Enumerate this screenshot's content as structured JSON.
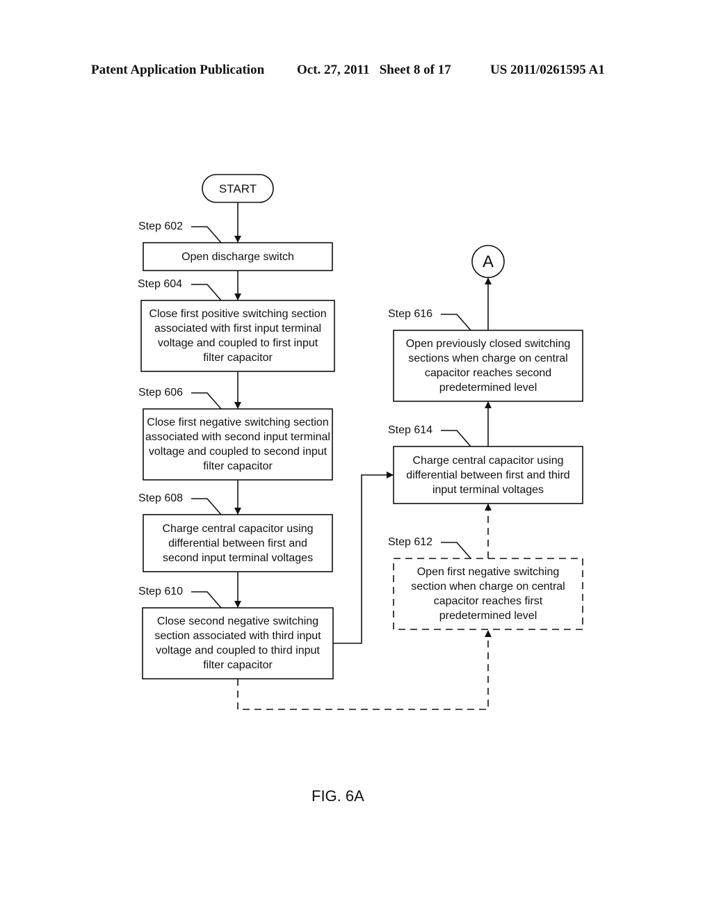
{
  "header": {
    "publication": "Patent Application Publication",
    "date_sheet": "Oct. 27, 2011   Sheet 8 of 17",
    "number": "US 2011/0261595 A1"
  },
  "diagram": {
    "start": "START",
    "connector": "A",
    "steps": [
      {
        "id": "602",
        "label": "Step 602",
        "text": "Open discharge switch",
        "style": "solid"
      },
      {
        "id": "604",
        "label": "Step 604",
        "text": "Close first positive switching section associated with first input terminal voltage and coupled to first input filter capacitor",
        "style": "solid"
      },
      {
        "id": "606",
        "label": "Step 606",
        "text": "Close first negative switching section associated with second input terminal voltage and coupled to second input filter capacitor",
        "style": "solid"
      },
      {
        "id": "608",
        "label": "Step 608",
        "text": "Charge central capacitor using differential between first and second input terminal voltages",
        "style": "solid"
      },
      {
        "id": "610",
        "label": "Step 610",
        "text": "Close second negative switching section associated with third input voltage and coupled to third input filter capacitor",
        "style": "solid"
      },
      {
        "id": "612",
        "label": "Step 612",
        "text": "Open first negative switching section when charge on central capacitor reaches first predetermined level",
        "style": "dashed"
      },
      {
        "id": "614",
        "label": "Step 614",
        "text": "Charge central capacitor using differential between first and third input terminal voltages",
        "style": "solid"
      },
      {
        "id": "616",
        "label": "Step 616",
        "text": "Open previously closed switching sections when charge on central capacitor reaches second predetermined level",
        "style": "solid"
      }
    ],
    "edges": [
      {
        "from": "START",
        "to": "602",
        "style": "solid"
      },
      {
        "from": "602",
        "to": "604",
        "style": "solid"
      },
      {
        "from": "604",
        "to": "606",
        "style": "solid"
      },
      {
        "from": "606",
        "to": "608",
        "style": "solid"
      },
      {
        "from": "608",
        "to": "610",
        "style": "solid"
      },
      {
        "from": "610",
        "to": "614",
        "style": "solid"
      },
      {
        "from": "610",
        "to": "612",
        "style": "dashed"
      },
      {
        "from": "612",
        "to": "614",
        "style": "dashed"
      },
      {
        "from": "614",
        "to": "616",
        "style": "solid"
      },
      {
        "from": "616",
        "to": "A",
        "style": "solid"
      }
    ],
    "caption": "FIG. 6A"
  }
}
